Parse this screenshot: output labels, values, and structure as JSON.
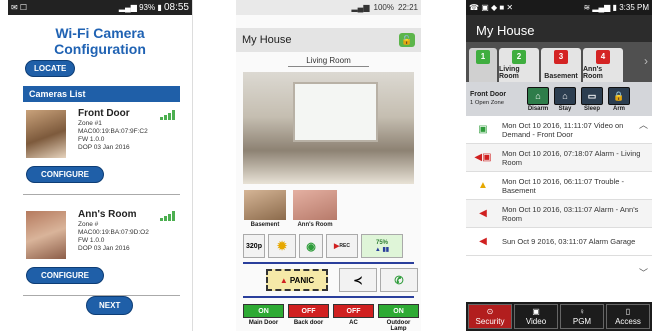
{
  "screen1": {
    "status": {
      "time": "08:55",
      "battery": "93%"
    },
    "title": "Wi-Fi Camera Configuration",
    "locate_label": "LOCATE",
    "list_header": "Cameras List",
    "cameras": [
      {
        "name": "Front Door",
        "zone": "Zone #1",
        "mac": "MAC00:19:BA:07:9F:C2",
        "fw": "FW 1.0.0",
        "dop": "DOP 03 Jan 2016"
      },
      {
        "name": "Ann's Room",
        "zone": "Zone #",
        "mac": "MAC00:19:BA:07:9D:O2",
        "fw": "FW 1.0.0",
        "dop": "DOP 03 Jan 2016"
      }
    ],
    "configure_label": "CONFIGURE",
    "next_label": "NEXT"
  },
  "screen2": {
    "status": {
      "battery": "100%",
      "time": "22:21"
    },
    "title": "My House",
    "room": "Living Room",
    "thumbs": [
      "Basement",
      "Ann's Room"
    ],
    "controls": {
      "resolution": "320p",
      "rec": "REC",
      "level": "75%"
    },
    "panic_label": "PANIC",
    "outputs": [
      {
        "state": "ON",
        "label": "Main Door"
      },
      {
        "state": "OFF",
        "label": "Back door"
      },
      {
        "state": "OFF",
        "label": "AC"
      },
      {
        "state": "ON",
        "label": "Outdoor Lamp"
      }
    ]
  },
  "screen3": {
    "status": {
      "time": "3:35 PM"
    },
    "title": "My House",
    "tabs": [
      {
        "num": "1",
        "label": ""
      },
      {
        "num": "2",
        "label": "Living Room"
      },
      {
        "num": "3",
        "label": "Basement"
      },
      {
        "num": "4",
        "label": "Ann's Room"
      }
    ],
    "partition": {
      "name": "Front Door",
      "zone": "1 Open Zone"
    },
    "modes": [
      "Disarm",
      "Stay",
      "Sleep",
      "Arm"
    ],
    "events": [
      {
        "icon": "video-icon",
        "text": "Mon Oct 10 2016, 11:11:07 Video on Demand - Front Door"
      },
      {
        "icon": "alarm-video-icon",
        "text": "Mon Oct 10 2016, 07:18:07 Alarm - Living Room"
      },
      {
        "icon": "warning-icon",
        "text": "Mon Oct 10 2016, 06:11:07 Trouble - Basement"
      },
      {
        "icon": "alarm-icon",
        "text": "Mon Oct 10 2016, 03:11:07 Alarm - Ann's Room"
      },
      {
        "icon": "alarm-icon",
        "text": "Sun Oct 9 2016, 03:11:07 Alarm Garage"
      }
    ],
    "bottom_nav": [
      "Security",
      "Video",
      "PGM",
      "Access"
    ]
  }
}
